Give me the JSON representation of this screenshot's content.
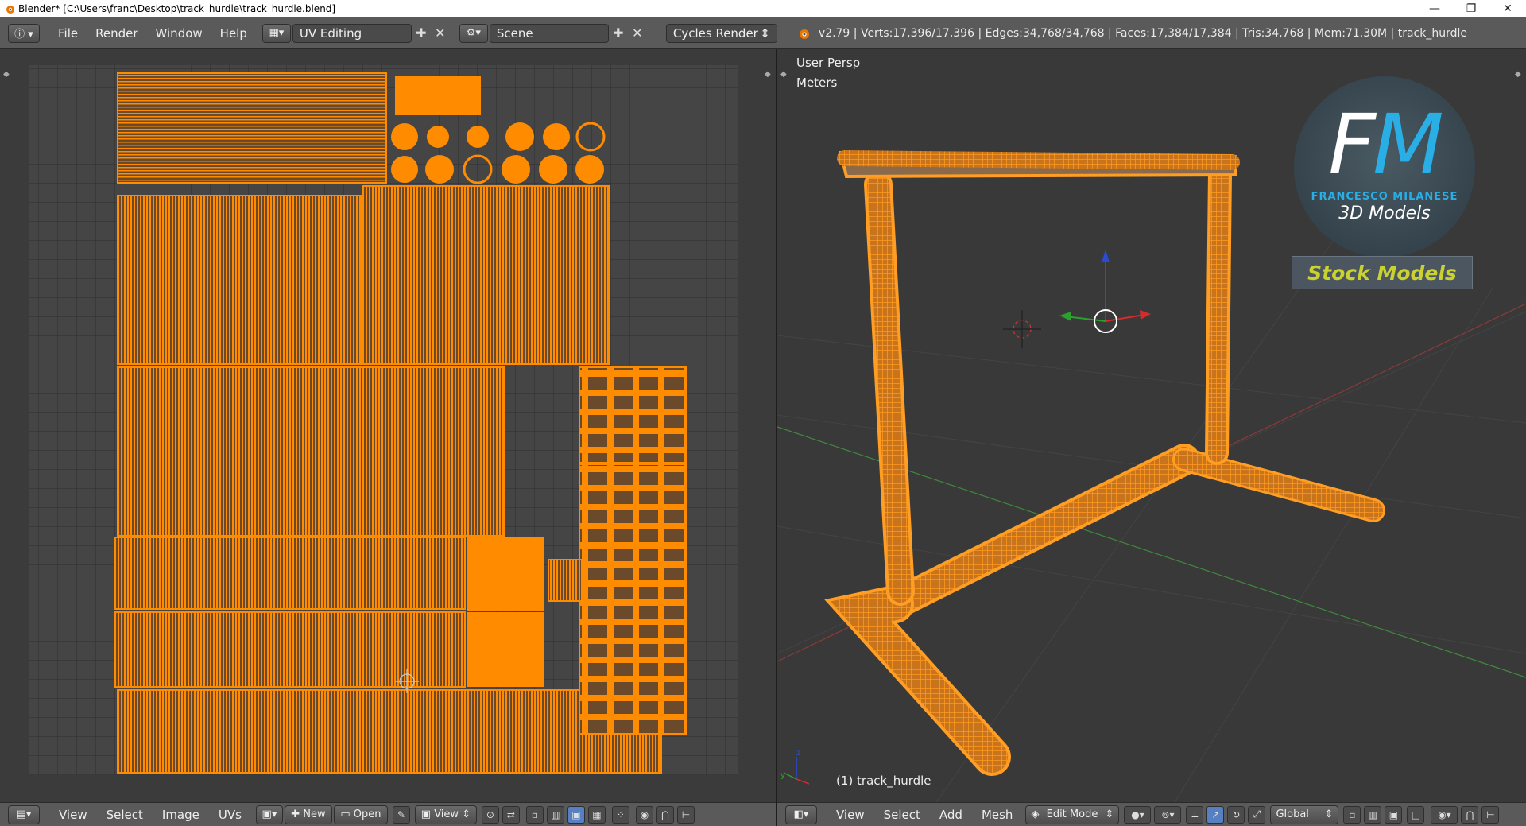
{
  "window": {
    "title": "Blender* [C:\\Users\\franc\\Desktop\\track_hurdle\\track_hurdle.blend]",
    "minimize": "—",
    "restore": "❐",
    "close": "✕"
  },
  "info_header": {
    "menus": [
      "File",
      "Render",
      "Window",
      "Help"
    ],
    "screen_layout": "UV Editing",
    "scene": "Scene",
    "render_engine": "Cycles Render",
    "stats": "v2.79 | Verts:17,396/17,396 | Edges:34,768/34,768 | Faces:17,384/17,384 | Tris:34,768 | Mem:71.30M | track_hurdle"
  },
  "uv_editor": {
    "menus": [
      "View",
      "Select",
      "Image",
      "UVs"
    ],
    "new_label": "New",
    "open_label": "Open",
    "view_label": "View"
  },
  "viewport": {
    "perspective": "User Persp",
    "units": "Meters",
    "object_label": "(1) track_hurdle",
    "menus": [
      "View",
      "Select",
      "Add",
      "Mesh"
    ],
    "mode": "Edit Mode",
    "orientation": "Global"
  },
  "watermark": {
    "initials_f": "F",
    "initials_m": "M",
    "name": "FRANCESCO MILANESE",
    "subtitle": "3D Models",
    "badge": "Stock Models"
  },
  "colors": {
    "accent_orange": "#ff8c00",
    "uv_background": "#3b3b3b",
    "header": "#5a5a5a"
  }
}
